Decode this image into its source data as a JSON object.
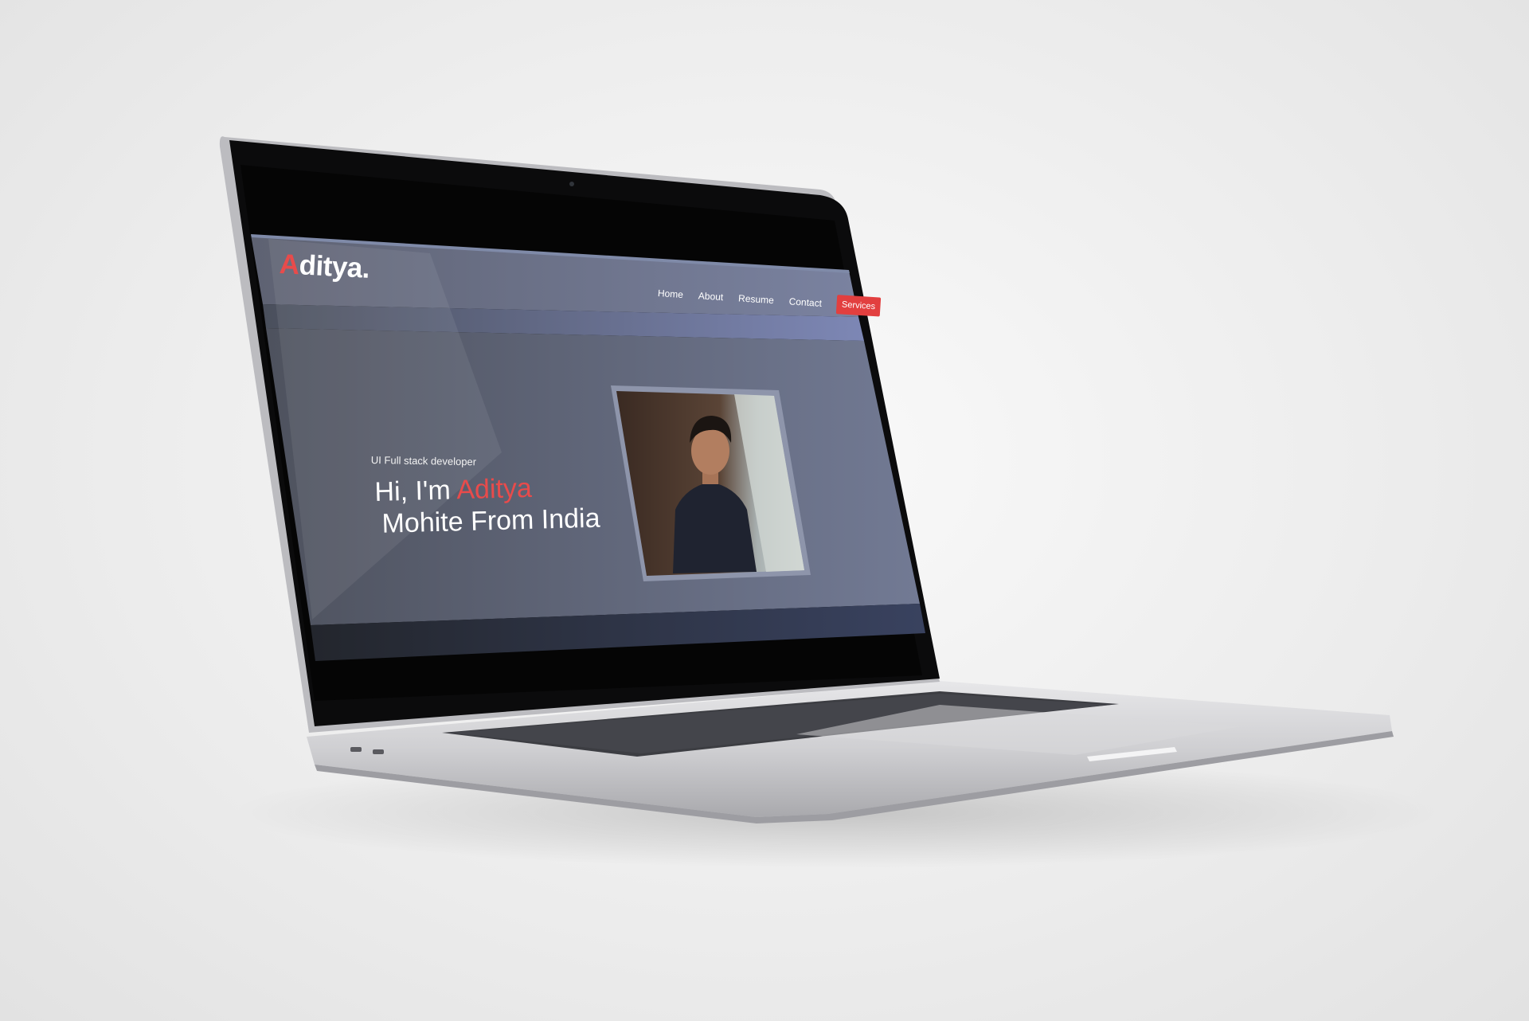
{
  "brand": {
    "initial": "A",
    "rest": "ditya."
  },
  "nav": {
    "items": [
      "Home",
      "About",
      "Resume",
      "Contact"
    ],
    "cta": "Services"
  },
  "hero": {
    "subtitle": "UI Full stack developer",
    "greeting": "Hi, I'm ",
    "name_highlight": "Aditya",
    "line2": "Mohite From India"
  },
  "colors": {
    "accent": "#e84b4b",
    "button": "#e23f3f",
    "nav_bg": "#6d7385",
    "hero_bg": "#5d6274"
  }
}
